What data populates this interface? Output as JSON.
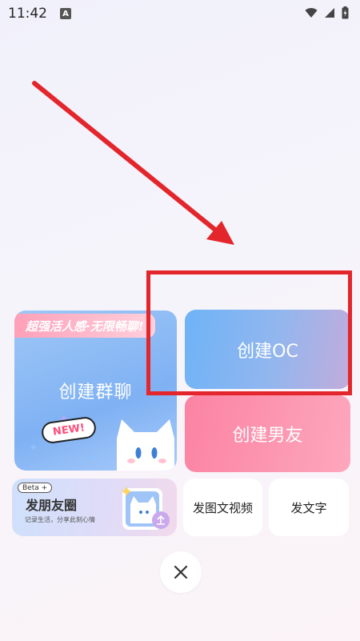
{
  "status_bar": {
    "time": "11:42",
    "notification_badge": "A"
  },
  "cards": {
    "group_chat": {
      "ribbon": "超强活人感·无限畅聊!",
      "title": "创建群聊",
      "badge": "NEW!"
    },
    "create_oc": {
      "label": "创建OC"
    },
    "create_boyfriend": {
      "label": "创建男友"
    },
    "moments": {
      "beta": "Beta",
      "title": "发朋友圈",
      "subtitle": "记录生活，分享此刻心情"
    },
    "post_video": {
      "label": "发图文视频"
    },
    "post_text": {
      "label": "发文字"
    }
  },
  "close_button": {
    "icon": "close-icon"
  },
  "annotation": {
    "color": "#e3262b"
  }
}
